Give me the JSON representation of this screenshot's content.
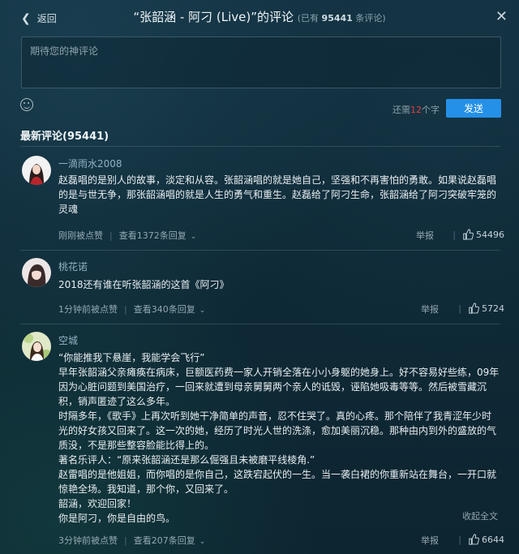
{
  "header": {
    "back_label": "返回",
    "title": "“张韶涵 - 阿刁 (Live)”的评论",
    "count_prefix": "(已有 ",
    "count_value": "95441",
    "count_suffix": " 条评论)"
  },
  "composer": {
    "placeholder": "期待您的神评论",
    "remain_prefix": "还需",
    "remain_num": "12",
    "remain_suffix": "个字",
    "send_label": "发送"
  },
  "section": {
    "title": "最新评论(95441)"
  },
  "comments": [
    {
      "user": "一滴雨水2008",
      "lines": [
        "赵磊唱的是别人的故事，淡定和从容。张韶涵唱的就是她自己，坚强和不再害怕的勇敢。如果说赵磊唱",
        "的是与世无争，那张韶涵唱的就是人生的勇气和重生。赵磊给了阿刁生命，张韶涵给了阿刁突破牢笼的",
        "灵魂"
      ],
      "time": "刚刚被点赞",
      "replies": "查看1372条回复",
      "report": "举报",
      "likes": "54496"
    },
    {
      "user": "桃花诺",
      "lines": [
        "2018还有谁在听张韶涵的这首《阿刁》"
      ],
      "time": "1分钟前被点赞",
      "replies": "查看340条回复",
      "report": "举报",
      "likes": "5724"
    },
    {
      "user": "空城",
      "lines": [
        "“你能推我下悬崖，我能学会飞行”",
        "早年张韶涵父亲瘫痪在病床，巨额医药费一家人开销全落在小小身躯的她身上。好不容易好些练，09年",
        "因为心脏问题到美国治疗，一回来就遭到母亲舅舅两个亲人的诋毁，诬陷她吸毒等等。然后被雪藏沉",
        "积，销声匿迹了这么多年。",
        "时隔多年，《歌手》上再次听到她干净简单的声音，忍不住哭了。真的心疼。那个陪伴了我青涩年少时",
        "光的好女孩又回来了。这一次的她，经历了时光人世的洗涤，愈加美丽沉稳。那种由内到外的盛放的气",
        "质没，不是那些整容脸能比得上的。",
        "著名乐评人：“原来张韶涵还是那么倔强且未被磨平线棱角.”",
        "赵雷唱的是他姐姐，而你唱的是你自己，这跌宕起伏的一生。当一袭白裙的你重新站在舞台，一开口就",
        "惊艳全场。我知道，那个你，又回来了。",
        "韶涵，欢迎回家！",
        "你是阿刁，你是自由的鸟。"
      ],
      "collapse": "收起全文",
      "time": "3分钟前被点赞",
      "replies": "查看207条回复",
      "report": "举报",
      "likes": "6644"
    }
  ],
  "colors": {
    "accent": "#2490e8",
    "warning": "#e04040",
    "username": "#8fb3c2"
  }
}
